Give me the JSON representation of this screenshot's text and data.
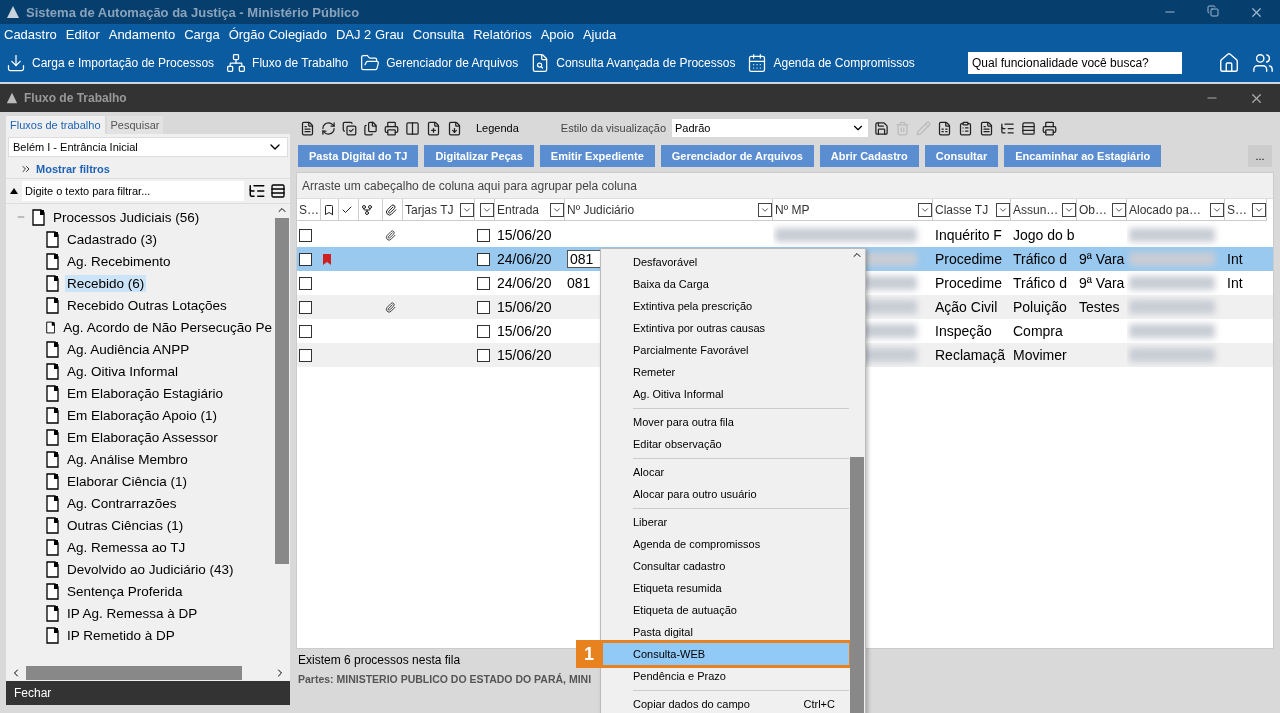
{
  "app_title": "Sistema de Automação da Justiça - Ministério Público",
  "menu": [
    "Cadastro",
    "Editor",
    "Andamento",
    "Carga",
    "Órgão Colegiado",
    "DAJ 2 Grau",
    "Consulta",
    "Relatórios",
    "Apoio",
    "Ajuda"
  ],
  "toolbar": [
    "Carga e Importação de Processos",
    "Fluxo de Trabalho",
    "Gerenciador de Arquivos",
    "Consulta Avançada de Processos",
    "Agenda de Compromissos"
  ],
  "search": {
    "placeholder": "Qual funcionalidade você busca?"
  },
  "workflow_window": {
    "title": "Fluxo de Trabalho"
  },
  "left_panel": {
    "tabs": [
      {
        "label": "Fluxos de trabalho",
        "selected": true
      },
      {
        "label": "Pesquisar",
        "selected": false
      }
    ],
    "unit_select": {
      "value": "Belém I - Entrância Inicial"
    },
    "filters_link": "Mostrar filtros",
    "filter": {
      "placeholder": "Digite o texto para filtrar..."
    },
    "tree": [
      {
        "label": "Processos Judiciais (56)",
        "expanded": true,
        "selected": false,
        "children": [
          {
            "label": "Cadastrado (3)",
            "selected": false
          },
          {
            "label": "Ag. Recebimento",
            "selected": false
          },
          {
            "label": "Recebido (6)",
            "selected": true
          },
          {
            "label": "Recebido Outras Lotações",
            "selected": false
          },
          {
            "label": "Ag. Acordo de Não Persecução Pe",
            "selected": false
          },
          {
            "label": "Ag. Audiência ANPP",
            "selected": false
          },
          {
            "label": "Ag. Oitiva Informal",
            "selected": false
          },
          {
            "label": "Em Elaboração Estagiário",
            "selected": false
          },
          {
            "label": "Em Elaboração Apoio (1)",
            "selected": false
          },
          {
            "label": "Em Elaboração Assessor",
            "selected": false
          },
          {
            "label": "Ag. Análise Membro",
            "selected": false
          },
          {
            "label": "Elaborar Ciência (1)",
            "selected": false
          },
          {
            "label": "Ag. Contrarrazões",
            "selected": false
          },
          {
            "label": "Outras Ciências (1)",
            "selected": false
          },
          {
            "label": "Ag. Remessa ao TJ",
            "selected": false
          },
          {
            "label": "Devolvido ao Judiciário (43)",
            "selected": false
          },
          {
            "label": "Sentença Proferida",
            "selected": false
          },
          {
            "label": "IP Ag. Remessa à DP",
            "selected": false
          },
          {
            "label": "IP Remetido à DP",
            "selected": false
          }
        ]
      }
    ],
    "close_button": "Fechar"
  },
  "main": {
    "legend": "Legenda",
    "view_style": {
      "label": "Estilo da visualização",
      "value": "Padrão"
    },
    "actions": [
      "Pasta Digital do TJ",
      "Digitalizar Peças",
      "Emitir Expediente",
      "Gerenciador de Arquivos",
      "Abrir Cadastro",
      "Consultar",
      "Encaminhar ao Estagiário"
    ],
    "more": "...",
    "group_hint": "Arraste um cabeçalho de coluna aqui para agrupar pela coluna",
    "columns": [
      {
        "kind": "text",
        "label": "S…"
      },
      {
        "kind": "bookmark"
      },
      {
        "kind": "check"
      },
      {
        "kind": "tree"
      },
      {
        "kind": "clip"
      },
      {
        "kind": "text",
        "label": "Tarjas TJ",
        "filter": true
      },
      {
        "kind": "blank",
        "filter": true
      },
      {
        "kind": "text",
        "label": "Entrada",
        "filter": true
      },
      {
        "kind": "text",
        "label": "Nº Judiciário",
        "filter": true
      },
      {
        "kind": "text",
        "label": "Nº MP",
        "filter": true
      },
      {
        "kind": "text",
        "label": "Classe TJ",
        "filter": true
      },
      {
        "kind": "text",
        "label": "Assun…",
        "filter": true
      },
      {
        "kind": "text",
        "label": "Ob…",
        "filter": true
      },
      {
        "kind": "text",
        "label": "Alocado pa…",
        "filter": true
      },
      {
        "kind": "text",
        "label": "S…",
        "filter": true
      }
    ],
    "rows": [
      {
        "selected": false,
        "checked": false,
        "flagged": false,
        "attachment": true,
        "entry_checked": false,
        "entrada": "15/06/20",
        "judicial": "",
        "editing": false,
        "classe": "Inquérito F",
        "assunto": "Jogo do b",
        "obs": "",
        "status": ""
      },
      {
        "selected": true,
        "checked": false,
        "flagged": true,
        "attachment": false,
        "entry_checked": false,
        "entrada": "24/06/20",
        "judicial": "081",
        "editing": true,
        "classe": "Procedime",
        "assunto": "Tráfico d",
        "obs": "9ª Vara",
        "status": "Int"
      },
      {
        "selected": false,
        "checked": false,
        "flagged": false,
        "attachment": false,
        "entry_checked": false,
        "entrada": "24/06/20",
        "judicial": "081",
        "editing": false,
        "classe": "Procedime",
        "assunto": "Tráfico d",
        "obs": "9ª Vara",
        "status": "Int"
      },
      {
        "selected": false,
        "checked": false,
        "flagged": false,
        "attachment": true,
        "entry_checked": false,
        "entrada": "15/06/20",
        "judicial": "",
        "editing": false,
        "classe": "Ação Civil",
        "assunto": "Poluição",
        "obs": "Testes",
        "status": ""
      },
      {
        "selected": false,
        "checked": false,
        "flagged": false,
        "attachment": false,
        "entry_checked": false,
        "entrada": "15/06/20",
        "judicial": "",
        "editing": false,
        "classe": "Inspeção",
        "assunto": "Compra",
        "obs": "",
        "status": ""
      },
      {
        "selected": false,
        "checked": false,
        "flagged": false,
        "attachment": false,
        "entry_checked": false,
        "entrada": "15/06/20",
        "judicial": "",
        "editing": false,
        "classe": "Reclamaçã",
        "assunto": "Movimer",
        "obs": "",
        "status": ""
      }
    ],
    "count": "Existem 6 processos nesta fila",
    "parties": "Partes: MINISTERIO PUBLICO DO ESTADO DO PARÁ, MINI"
  },
  "context_menu": {
    "items": [
      {
        "kind": "item",
        "label": "Desfavorável",
        "highlighted": false
      },
      {
        "kind": "item",
        "label": "Baixa da Carga",
        "highlighted": false
      },
      {
        "kind": "item",
        "label": "Extintiva pela prescrição",
        "highlighted": false
      },
      {
        "kind": "item",
        "label": "Extintiva por outras causas",
        "highlighted": false
      },
      {
        "kind": "item",
        "label": "Parcialmente Favorável",
        "highlighted": false
      },
      {
        "kind": "item",
        "label": "Remeter",
        "highlighted": false
      },
      {
        "kind": "item",
        "label": "Ag. Oitiva Informal",
        "highlighted": false
      },
      {
        "kind": "separator"
      },
      {
        "kind": "item",
        "label": "Mover para outra fila",
        "highlighted": false
      },
      {
        "kind": "item",
        "label": "Editar observação",
        "highlighted": false
      },
      {
        "kind": "separator"
      },
      {
        "kind": "item",
        "label": "Alocar",
        "highlighted": false
      },
      {
        "kind": "item",
        "label": "Alocar para outro usuário",
        "highlighted": false
      },
      {
        "kind": "separator"
      },
      {
        "kind": "item",
        "label": "Liberar",
        "highlighted": false
      },
      {
        "kind": "item",
        "label": "Agenda de compromissos",
        "highlighted": false
      },
      {
        "kind": "item",
        "label": "Consultar cadastro",
        "highlighted": false
      },
      {
        "kind": "item",
        "label": "Etiqueta resumida",
        "highlighted": false
      },
      {
        "kind": "item",
        "label": "Etiqueta de autuação",
        "highlighted": false
      },
      {
        "kind": "item",
        "label": "Pasta digital",
        "highlighted": false
      },
      {
        "kind": "item",
        "label": "Consulta-WEB",
        "highlighted": true
      },
      {
        "kind": "item",
        "label": "Pendência e Prazo",
        "highlighted": false
      },
      {
        "kind": "separator"
      },
      {
        "kind": "item",
        "label": "Copiar dados do campo",
        "shortcut": "Ctrl+C",
        "highlighted": false
      }
    ],
    "callout": "1"
  }
}
